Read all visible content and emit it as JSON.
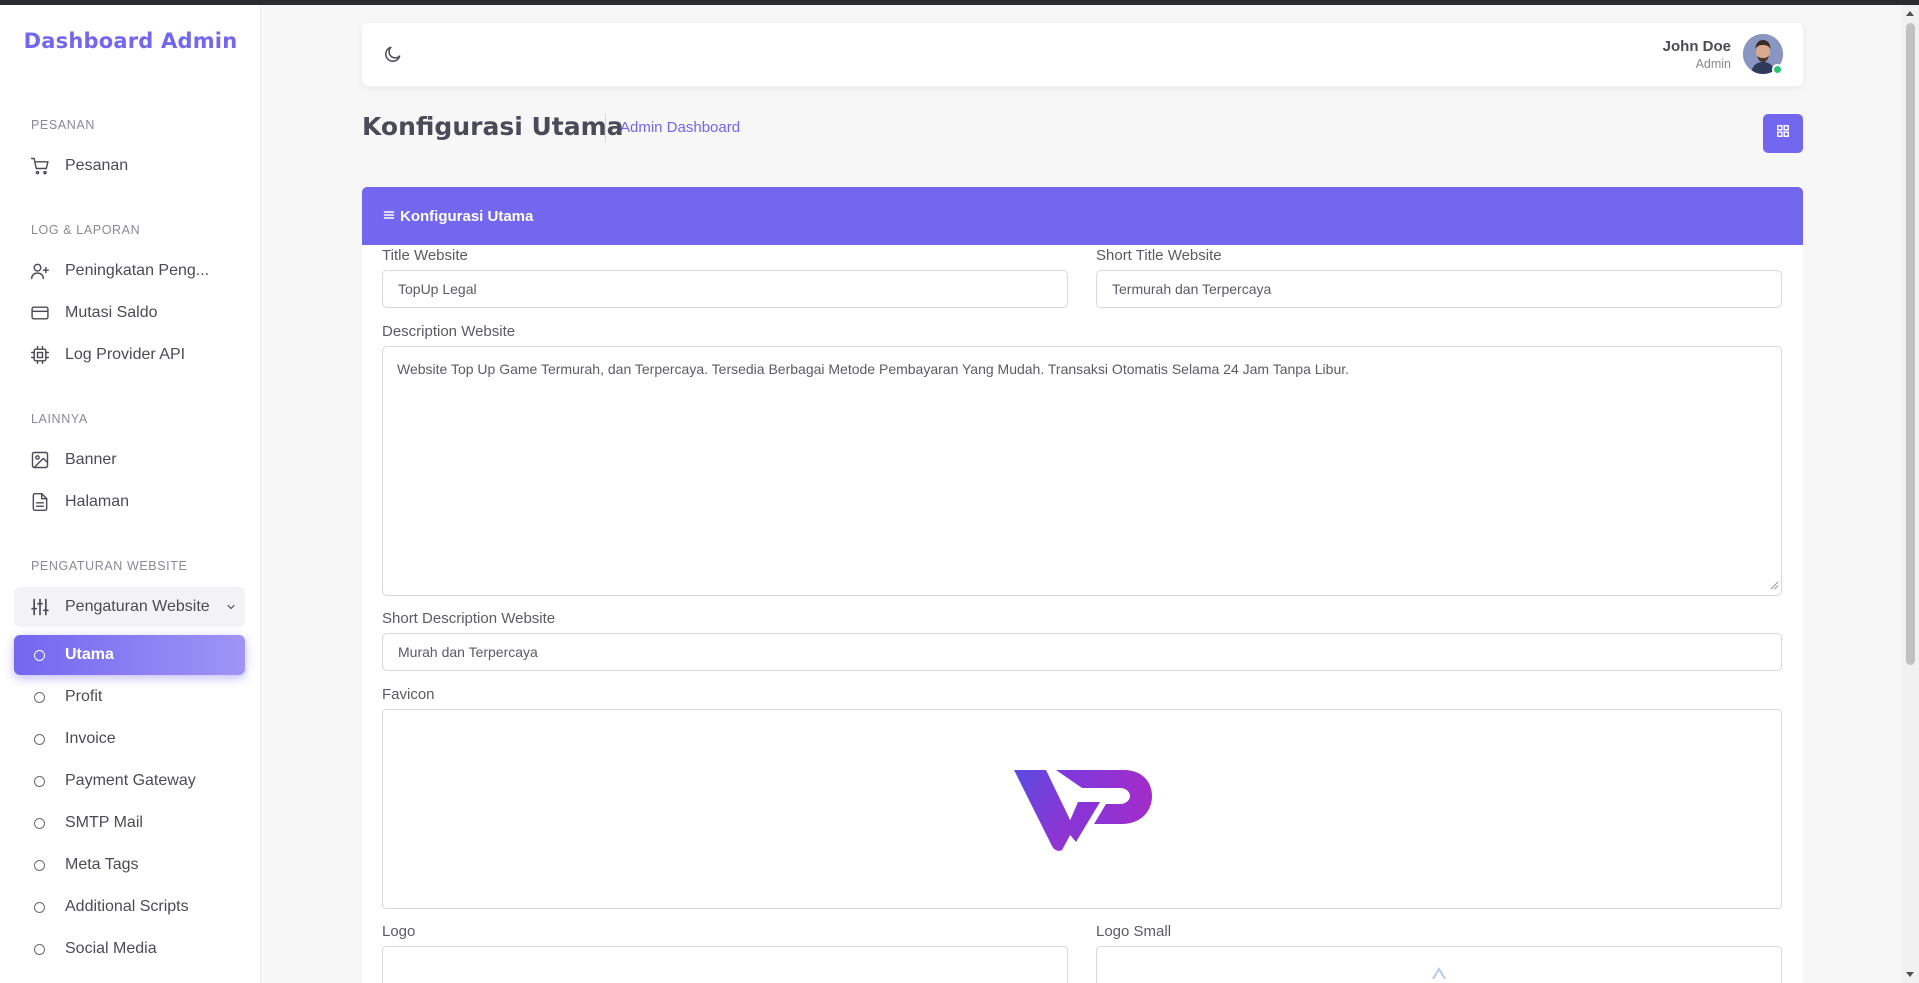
{
  "sidebar": {
    "brand": "Dashboard Admin",
    "sections": {
      "pesanan": "PESANAN",
      "log": "LOG & LAPORAN",
      "lainnya": "LAINNYA",
      "pengaturan": "PENGATURAN WEBSITE"
    },
    "items": {
      "pesanan": "Pesanan",
      "peningkatan": "Peningkatan Peng...",
      "mutasi": "Mutasi Saldo",
      "log_api": "Log Provider API",
      "banner": "Banner",
      "halaman": "Halaman",
      "pengaturan_website": "Pengaturan Website"
    },
    "subitems": [
      "Utama",
      "Profit",
      "Invoice",
      "Payment Gateway",
      "SMTP Mail",
      "Meta Tags",
      "Additional Scripts",
      "Social Media"
    ],
    "active_subitem": "Utama"
  },
  "header": {
    "user_name": "John Doe",
    "user_role": "Admin"
  },
  "page": {
    "title": "Konfigurasi Utama",
    "breadcrumb": "Admin Dashboard"
  },
  "card": {
    "title": "Konfigurasi Utama",
    "fields": {
      "title_website": {
        "label": "Title Website",
        "value": "TopUp Legal"
      },
      "short_title_website": {
        "label": "Short Title Website",
        "value": "Termurah dan Terpercaya"
      },
      "description_website": {
        "label": "Description Website",
        "value": "Website Top Up Game Termurah, dan Terpercaya. Tersedia Berbagai Metode Pembayaran Yang Mudah. Transaksi Otomatis Selama 24 Jam Tanpa Libur."
      },
      "short_description_website": {
        "label": "Short Description Website",
        "value": "Murah dan Terpercaya"
      },
      "favicon": {
        "label": "Favicon"
      },
      "logo": {
        "label": "Logo"
      },
      "logo_small": {
        "label": "Logo Small"
      }
    }
  },
  "colors": {
    "accent": "#7367f0",
    "online": "#28c76f"
  }
}
